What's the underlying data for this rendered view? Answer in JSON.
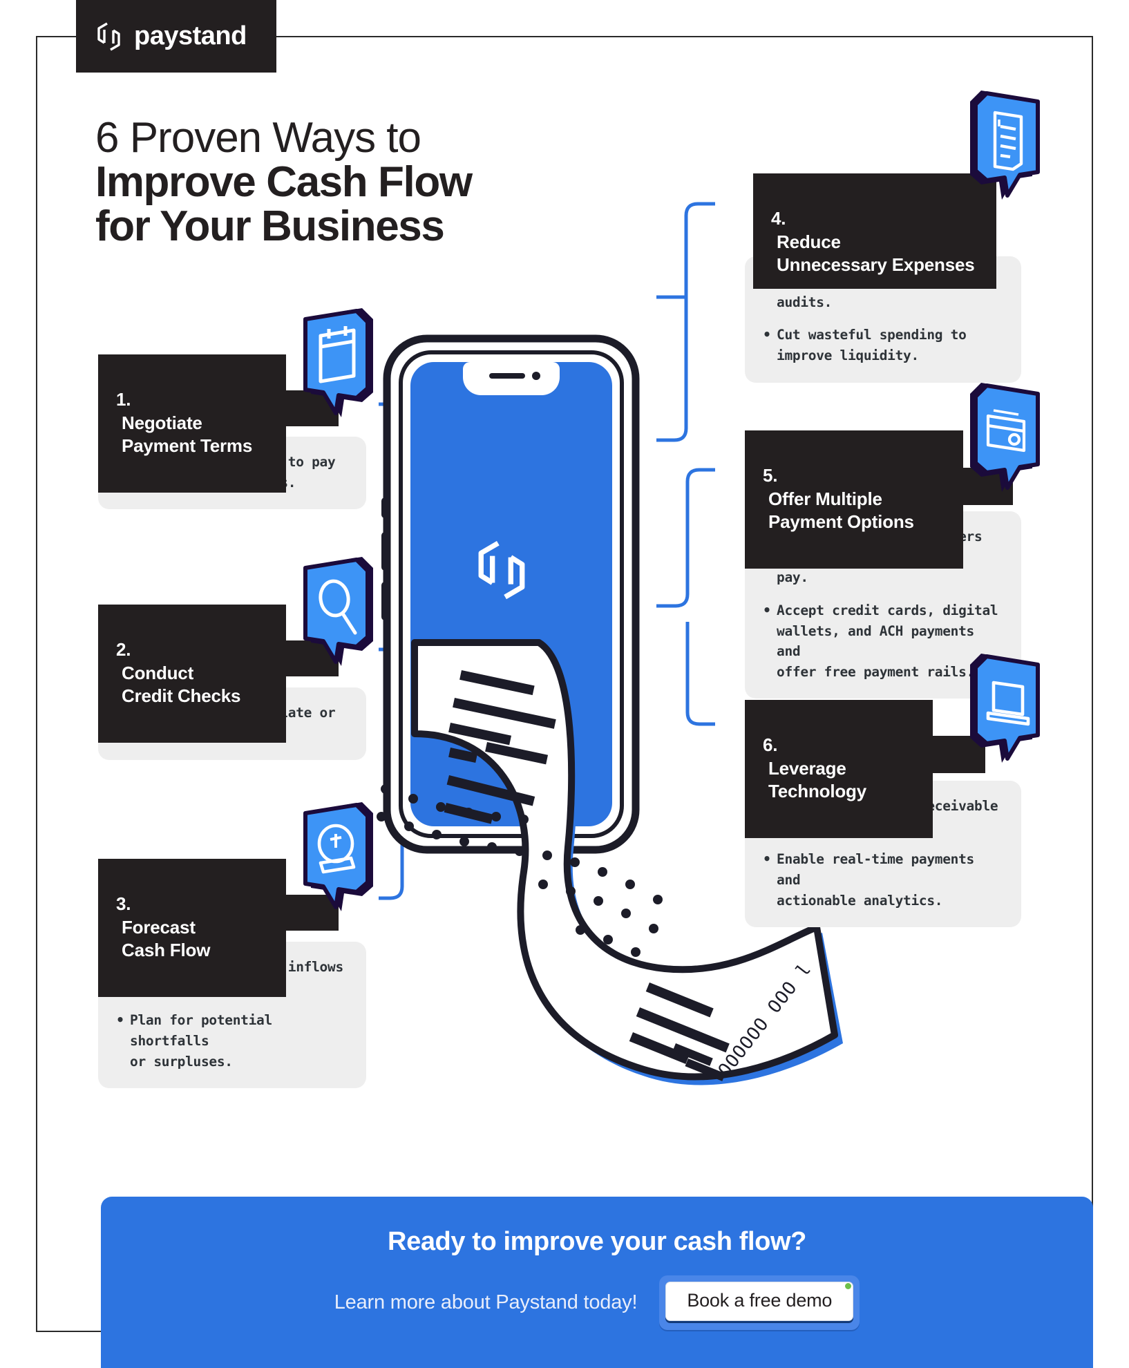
{
  "brand": {
    "name": "paystand",
    "logo_icon": "paystand-hexagon-logo",
    "accent_blue": "#2d74e0",
    "icon_blue": "#3d94f6",
    "dark": "#231f20",
    "card_grey": "#eeeeee"
  },
  "headline": {
    "line1": "6 Proven Ways to",
    "line2": "Improve Cash Flow",
    "line3": "for Your Business"
  },
  "steps": [
    {
      "id": 1,
      "number": "1.",
      "title": "Negotiate\nPayment Terms",
      "icon": "calendar-icon",
      "bullets": [
        "Encourage customers to pay\nearly with discounts."
      ]
    },
    {
      "id": 2,
      "number": "2.",
      "title": "Conduct\nCredit Checks",
      "icon": "magnifying-glass-icon",
      "bullets": [
        "Reduce the risk of late or\nmissed payments."
      ]
    },
    {
      "id": 3,
      "number": "3.",
      "title": "Forecast\nCash Flow",
      "icon": "crystal-ball-icon",
      "bullets": [
        "Predict future cash inflows\nand outflows.",
        "Plan for potential shortfalls\nor surpluses."
      ]
    },
    {
      "id": 4,
      "number": "4.",
      "title": "Reduce\nUnnecessary Expenses",
      "icon": "invoice-document-icon",
      "bullets": [
        "Conduct regular expense\naudits.",
        "Cut wasteful spending to\nimprove liquidity."
      ]
    },
    {
      "id": 5,
      "number": "5.",
      "title": "Offer Multiple\nPayment Options",
      "icon": "wallet-card-icon",
      "bullets": [
        "Make it easy for customers to\npay.",
        "Accept credit cards, digital\nwallets, and ACH payments and\noffer free payment rails."
      ]
    },
    {
      "id": 6,
      "number": "6.",
      "title": "Leverage\nTechnology",
      "icon": "laptop-icon",
      "bullets": [
        "Automate accounts receivable\nprocesses.",
        "Enable real-time payments and\nactionable analytics."
      ]
    }
  ],
  "illustration": {
    "phone_logo_icon": "paystand-hexagon-logo",
    "receipt_number": "OOOOOO OOO l"
  },
  "cta": {
    "title": "Ready to improve your cash flow?",
    "subtitle": "Learn more about Paystand today!",
    "button_label": "Book a free demo"
  }
}
